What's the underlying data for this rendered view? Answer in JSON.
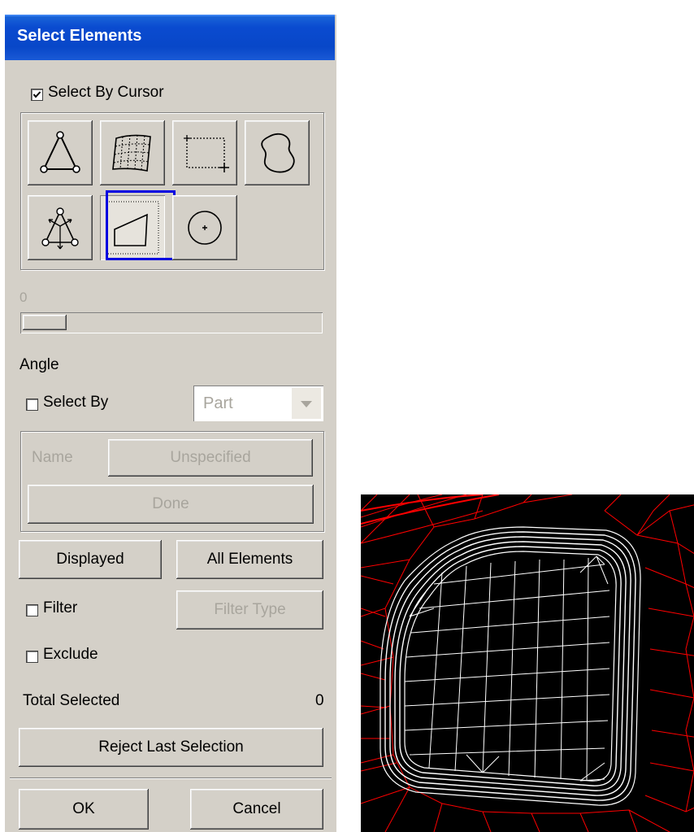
{
  "dialog": {
    "title": "Select Elements",
    "select_by_cursor": {
      "label": "Select By Cursor",
      "checked": true
    },
    "tools": [
      {
        "name": "triangle-element-icon",
        "selected": false
      },
      {
        "name": "surface-mesh-icon",
        "selected": false
      },
      {
        "name": "box-select-icon",
        "selected": false
      },
      {
        "name": "freehand-lasso-icon",
        "selected": false
      },
      {
        "name": "adjacent-elements-icon",
        "selected": false
      },
      {
        "name": "polygon-select-icon",
        "selected": true
      },
      {
        "name": "circle-select-icon",
        "selected": false
      }
    ],
    "slider": {
      "value_label": "0",
      "value": 0
    },
    "angle_label": "Angle",
    "select_by": {
      "label": "Select By",
      "checked": false,
      "dropdown_value": "Part"
    },
    "name_label": "Name",
    "unspecified_button": "Unspecified",
    "done_button": "Done",
    "displayed_button": "Displayed",
    "all_elements_button": "All Elements",
    "filter": {
      "label": "Filter",
      "checked": false
    },
    "filter_type_button": "Filter Type",
    "exclude": {
      "label": "Exclude",
      "checked": false
    },
    "total_selected_label": "Total Selected",
    "total_selected_value": "0",
    "reject_button": "Reject Last Selection",
    "ok_button": "OK",
    "cancel_button": "Cancel"
  },
  "viewport": {
    "background": "#000000",
    "mesh_color": "#ff0000",
    "boundary_color": "#ffffff"
  },
  "colors": {
    "title_bar": "#0a4bd0",
    "dialog_bg": "#d4d0c8",
    "selection_highlight": "#0000e0"
  }
}
